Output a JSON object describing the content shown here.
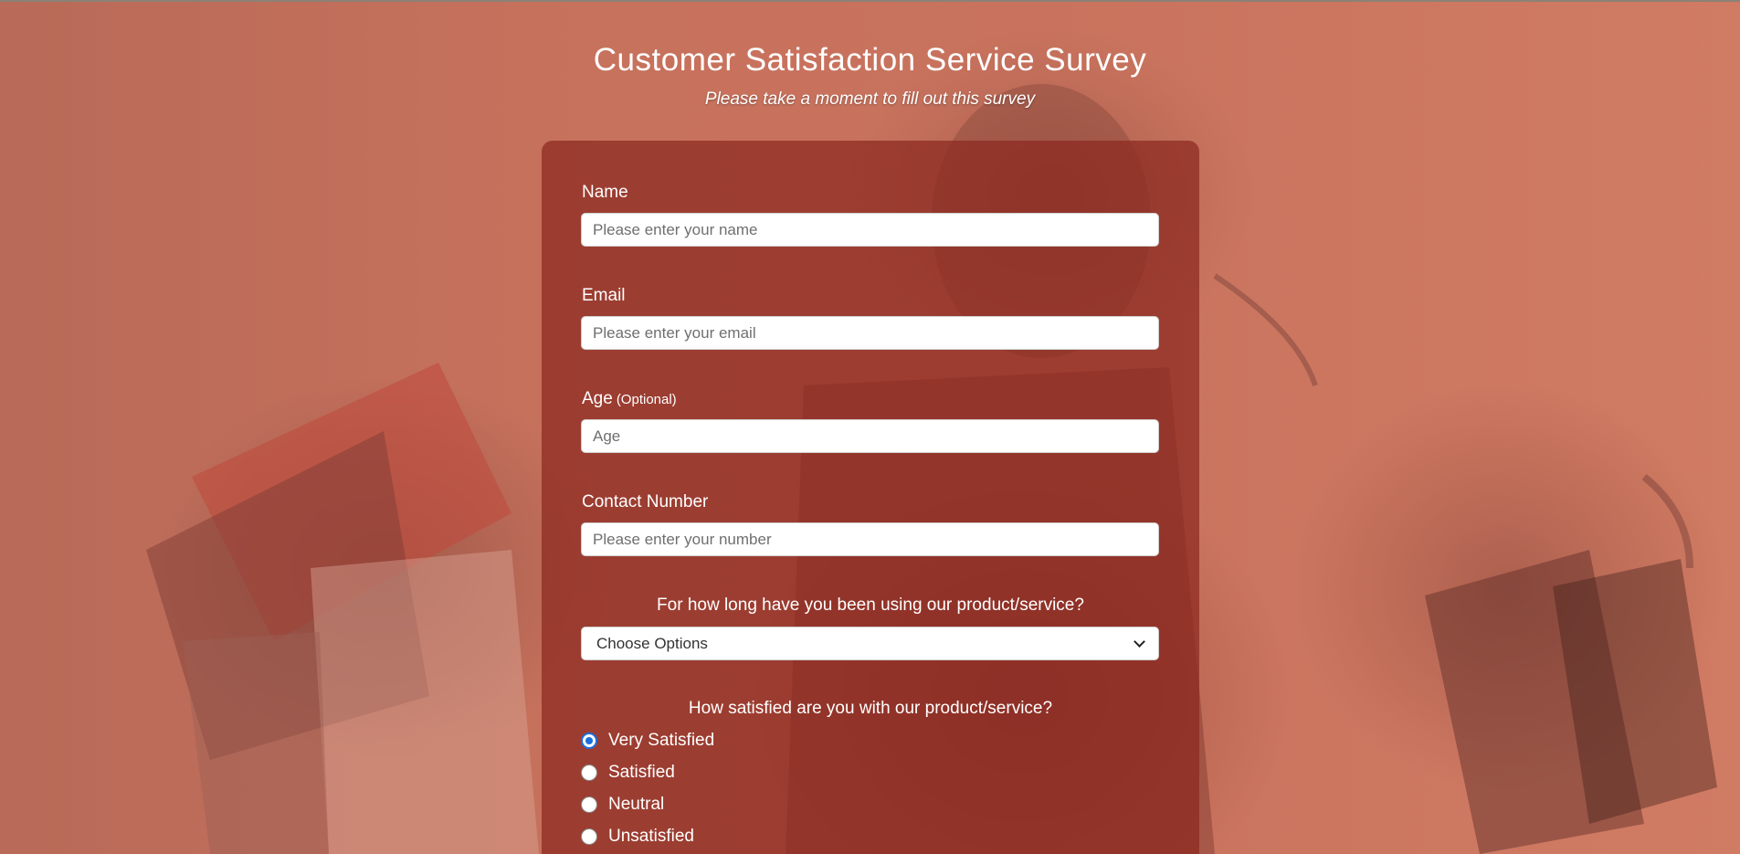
{
  "header": {
    "title": "Customer Satisfaction Service Survey",
    "subtitle": "Please take a moment to fill out this survey"
  },
  "form": {
    "name": {
      "label": "Name",
      "placeholder": "Please enter your name",
      "value": ""
    },
    "email": {
      "label": "Email",
      "placeholder": "Please enter your email",
      "value": ""
    },
    "age": {
      "label": "Age",
      "optional_note": "(Optional)",
      "placeholder": "Age",
      "value": ""
    },
    "contact": {
      "label": "Contact Number",
      "placeholder": "Please enter your number",
      "value": ""
    },
    "duration": {
      "question": "For how long have you been using our product/service?",
      "selected": "Choose Options"
    },
    "satisfaction": {
      "question": "How satisfied are you with our product/service?",
      "options": [
        {
          "label": "Very Satisfied",
          "checked": true
        },
        {
          "label": "Satisfied",
          "checked": false
        },
        {
          "label": "Neutral",
          "checked": false
        },
        {
          "label": "Unsatisfied",
          "checked": false
        }
      ]
    }
  },
  "colors": {
    "background": "#c9735f",
    "card": "#8c2820",
    "radio_accent": "#1a6fe0"
  },
  "icons": {
    "select_arrow": "chevron-down-icon"
  }
}
